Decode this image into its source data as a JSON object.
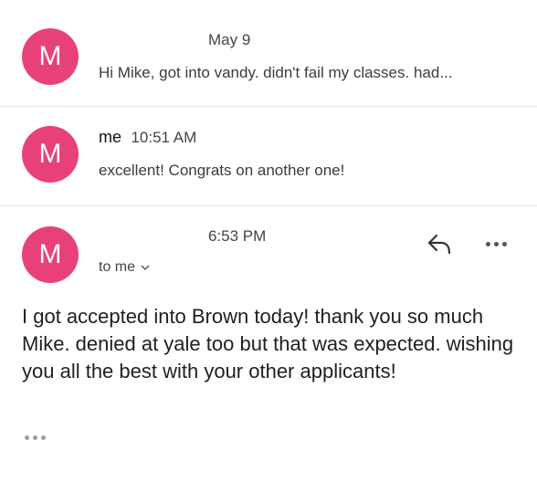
{
  "messages": [
    {
      "avatar_letter": "M",
      "date": "May 9",
      "preview": "Hi Mike, got into vandy. didn't fail my classes. had..."
    },
    {
      "avatar_letter": "M",
      "sender": "me",
      "time": "10:51 AM",
      "preview": "excellent! Congrats on another one!"
    },
    {
      "avatar_letter": "M",
      "time": "6:53 PM",
      "recipient": "to me",
      "body": "I got accepted into Brown today! thank you so much Mike. denied at yale too but that was expected. wishing you all the best with your other applicants!"
    }
  ],
  "icons": {
    "reply": "reply-arrow-icon",
    "more": "more-horizontal-icon",
    "expand": "chevron-down-icon",
    "trimmed": "show-trimmed-content-icon"
  },
  "colors": {
    "avatar": "#e8417a"
  }
}
